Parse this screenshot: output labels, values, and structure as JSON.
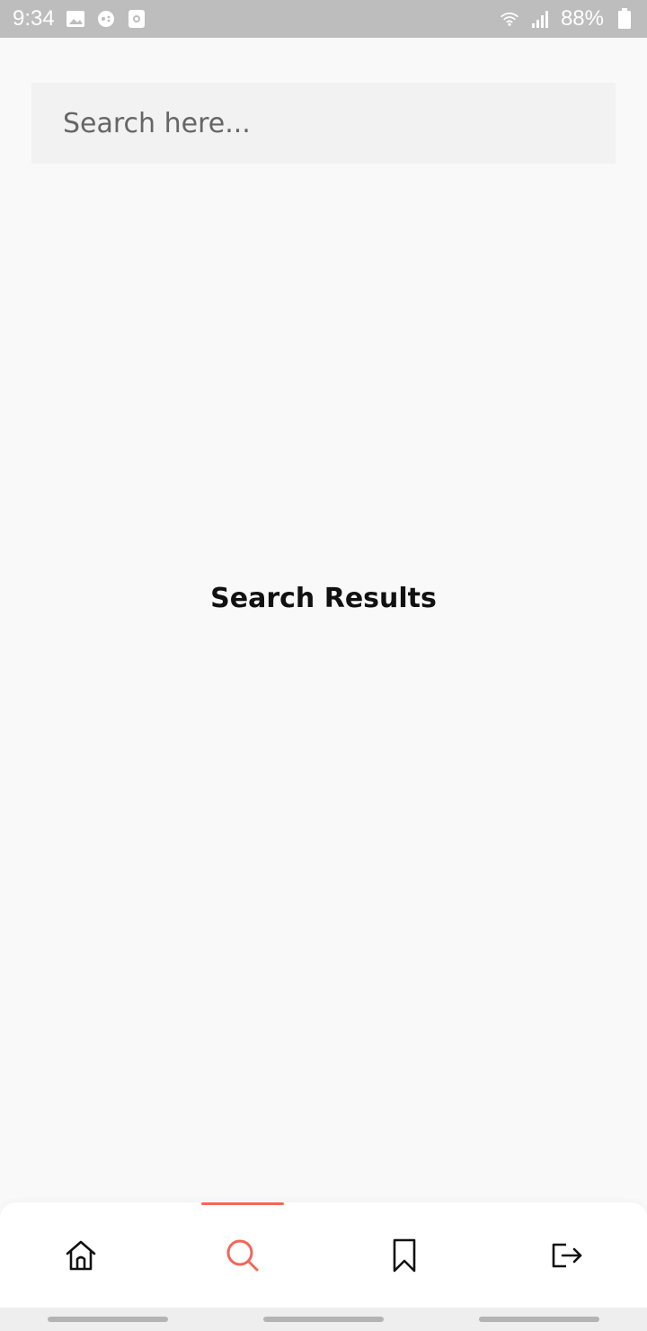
{
  "status_bar": {
    "time": "9:34",
    "battery_percent": "88%",
    "icons_left": [
      "image-icon",
      "game-controller-icon",
      "screen-record-icon"
    ],
    "icons_right": [
      "wifi-icon",
      "signal-icon",
      "battery-icon"
    ]
  },
  "search": {
    "placeholder": "Search here...",
    "value": ""
  },
  "main": {
    "results_title": "Search Results"
  },
  "bottom_nav": {
    "items": [
      {
        "icon": "home-icon",
        "active": false
      },
      {
        "icon": "search-icon",
        "active": true
      },
      {
        "icon": "bookmark-icon",
        "active": false
      },
      {
        "icon": "logout-icon",
        "active": false
      }
    ],
    "active_color": "#f2675a",
    "inactive_color": "#111111"
  },
  "colors": {
    "background": "#f9f9f9",
    "status_bar": "#bdbdbd",
    "search_field": "#f2f2f2",
    "accent": "#f2675a"
  }
}
